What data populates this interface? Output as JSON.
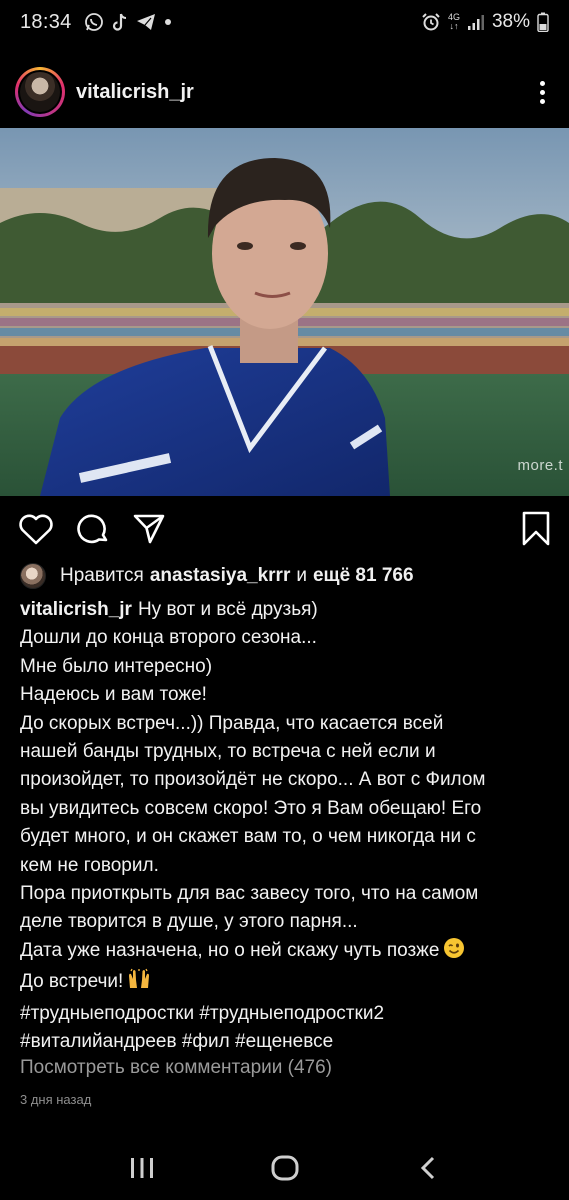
{
  "status_bar": {
    "time": "18:34",
    "network_label_top": "4G",
    "network_label_bottom": "↓↑",
    "battery": "38%",
    "left_icons": [
      "whatsapp-icon",
      "tiktok-icon",
      "telegram-icon",
      "notification-dot-icon"
    ],
    "right_icons": [
      "alarm-icon",
      "signal-icon",
      "battery-icon"
    ]
  },
  "post": {
    "username": "vitalicrish_jr",
    "photo_watermark": "more.t",
    "likes": {
      "prefix": "Нравится",
      "liked_by": "anastasiya_krrr",
      "conjunction": "и",
      "others": "ещё 81 766"
    },
    "caption": {
      "username": "vitalicrish_jr",
      "lines": [
        "Ну вот и всё друзья)",
        "Дошли до конца второго сезона...",
        "Мне было интересно)",
        "Надеюсь и вам тоже!",
        "До скорых встреч...)) Правда, что касается всей",
        "нашей банды трудных, то встреча с ней если и",
        "произойдет, то произойдёт не скоро... А вот с Филом",
        "вы увидитесь совсем скоро! Это я Вам обещаю! Его",
        "будет много, и он скажет вам то, о чем никогда ни с",
        "кем не говорил.",
        "Пора приоткрыть для вас завесу того, что на самом",
        "деле творится в душе, у этого парня...",
        "Дата уже назначена, но о ней скажу чуть позже",
        "До встречи!",
        "#трудныеподростки #трудныеподростки2",
        "#виталийандреев #фил #ещеневсе"
      ]
    },
    "view_comments": "Посмотреть все комментарии (476)",
    "time_ago": "3 дня назад"
  },
  "actions": [
    "heart-icon",
    "comment-icon",
    "share-icon",
    "bookmark-icon"
  ],
  "nav": [
    "recent-apps-icon",
    "home-icon",
    "back-icon"
  ]
}
